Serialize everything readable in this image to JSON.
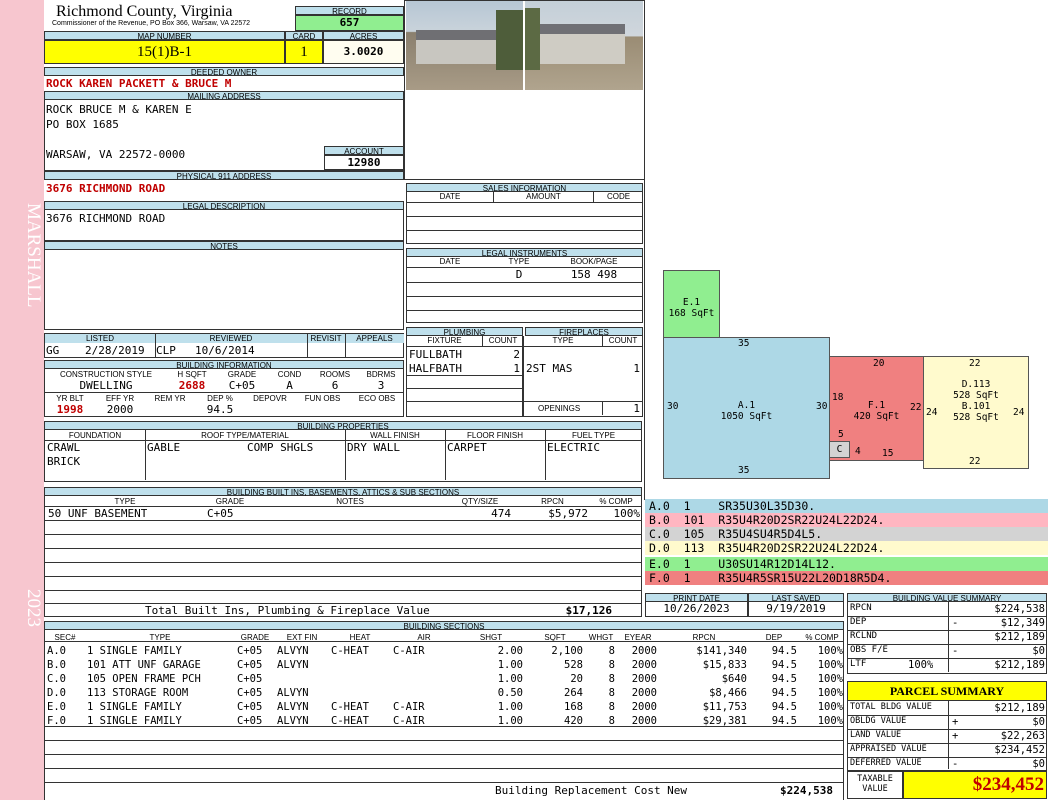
{
  "sidebar": {
    "owner_label": "MARSHALL",
    "year": "2023"
  },
  "header": {
    "county": "Richmond County, Virginia",
    "commissioner": "Commissioner of the Revenue, PO Box 366, Warsaw, VA 22572",
    "record_label": "RECORD",
    "record": "657",
    "map_label": "MAP NUMBER",
    "map_number": "15(1)B-1",
    "card_label": "CARD",
    "card": "1",
    "acres_label": "ACRES",
    "acres": "3.0020"
  },
  "owner": {
    "deeded_label": "DEEDED OWNER",
    "deeded": "ROCK KAREN PACKETT & BRUCE M",
    "mailing_label": "MAILING ADDRESS",
    "mailing_1": "ROCK BRUCE M & KAREN E",
    "mailing_2": "PO BOX 1685",
    "mailing_3": "WARSAW, VA 22572-0000",
    "account_label": "ACCOUNT",
    "account": "12980",
    "physical_label": "PHYSICAL 911 ADDRESS",
    "physical": "3676 RICHMOND ROAD",
    "legal_label": "LEGAL DESCRIPTION",
    "legal": "3676 RICHMOND ROAD",
    "notes_label": "NOTES"
  },
  "sales": {
    "title": "SALES INFORMATION",
    "cols": [
      "DATE",
      "AMOUNT",
      "CODE"
    ]
  },
  "legal_instruments": {
    "title": "LEGAL INSTRUMENTS",
    "cols": [
      "DATE",
      "TYPE",
      "BOOK/PAGE"
    ],
    "type": "D",
    "bookpage": "158 498"
  },
  "plumbing": {
    "title": "PLUMBING",
    "fixture_label": "FIXTURE",
    "count_label": "COUNT",
    "rows": [
      {
        "fixture": "FULLBATH",
        "count": "2"
      },
      {
        "fixture": "HALFBATH",
        "count": "1"
      }
    ]
  },
  "fireplaces": {
    "title": "FIREPLACES",
    "type_label": "TYPE",
    "count_label": "COUNT",
    "type": "2ST MAS",
    "count": "1",
    "openings_label": "OPENINGS",
    "openings": "1"
  },
  "listing": {
    "listed_label": "LISTED",
    "listed_by": "GG",
    "listed_date": "2/28/2019",
    "reviewed_label": "REVIEWED",
    "reviewed_by": "CLP",
    "reviewed_date": "10/6/2014",
    "revisit_label": "REVISIT",
    "appeals_label": "APPEALS"
  },
  "building_info": {
    "title": "BUILDING INFORMATION",
    "construction_label": "CONSTRUCTION STYLE",
    "construction": "DWELLING",
    "hsqft_label": "H SQFT",
    "hsqft": "2688",
    "grade_label": "GRADE",
    "grade": "C+05",
    "cond_label": "COND",
    "cond": "A",
    "rooms_label": "ROOMS",
    "rooms": "6",
    "bdrms_label": "BDRMS",
    "bdrms": "3",
    "yrblt_label": "YR BLT",
    "yrblt": "1998",
    "effyr_label": "EFF YR",
    "effyr": "2000",
    "remyr_label": "REM YR",
    "dep_label": "DEP %",
    "dep": "94.5",
    "depovr_label": "DEPOVR",
    "funobs_label": "FUN OBS",
    "ecoobs_label": "ECO OBS"
  },
  "properties": {
    "title": "BUILDING PROPERTIES",
    "foundation_label": "FOUNDATION",
    "foundation_1": "CRAWL",
    "foundation_2": "BRICK",
    "roof_label": "ROOF TYPE/MATERIAL",
    "roof_type": "GABLE",
    "roof_material": "COMP SHGLS",
    "wall_label": "WALL FINISH",
    "wall": "DRY WALL",
    "floor_label": "FLOOR FINISH",
    "floor": "CARPET",
    "fuel_label": "FUEL TYPE",
    "fuel": "ELECTRIC"
  },
  "builtins": {
    "title": "BUILDING BUILT INS, BASEMENTS, ATTICS & SUB SECTIONS",
    "cols": [
      "TYPE",
      "GRADE",
      "NOTES",
      "QTY/SIZE",
      "RPCN",
      "% COMP"
    ],
    "row": {
      "type": "50 UNF BASEMENT",
      "grade": "C+05",
      "qty": "474",
      "rpcn": "$5,972",
      "comp": "100%"
    },
    "total_label": "Total Built Ins, Plumbing & Fireplace Value",
    "total": "$17,126"
  },
  "segments": [
    {
      "id": "A.0",
      "code": "1",
      "path": "SR35U30L35D30.",
      "color": "#add8e6"
    },
    {
      "id": "B.0",
      "code": "101",
      "path": "R35U4R20D2SR22U24L22D24.",
      "color": "#ffb6c1"
    },
    {
      "id": "C.0",
      "code": "105",
      "path": "R35U4SU4R5D4L5.",
      "color": "#d3d3d3"
    },
    {
      "id": "D.0",
      "code": "113",
      "path": "R35U4R20D2SR22U24L22D24.",
      "color": "#fffacd"
    },
    {
      "id": "E.0",
      "code": "1",
      "path": "U30SU14R12D14L12.",
      "color": "#90ee90"
    },
    {
      "id": "F.0",
      "code": "1",
      "path": "R35U4R5SR15U22L20D18R5D4.",
      "color": "#f08080"
    }
  ],
  "sketch": {
    "e": {
      "label": "E.1",
      "area": "168 SqFt"
    },
    "a": {
      "label": "A.1",
      "area": "1050 SqFt",
      "top": "35",
      "bottom": "35",
      "left": "30",
      "right": "30"
    },
    "f": {
      "label": "F.1",
      "area": "420 SqFt",
      "top": "20",
      "left": "18",
      "right": "22",
      "bottom": "15"
    },
    "c": {
      "label": "C",
      "dim_top": "5",
      "dim_right": "4"
    },
    "d": {
      "label_d": "D.113",
      "area_d": "528 SqFt",
      "label_b": "B.101",
      "area_b": "528 SqFt",
      "top": "22",
      "bottom": "22",
      "left": "24",
      "right": "24"
    }
  },
  "dates": {
    "print_label": "PRINT DATE",
    "print": "10/26/2023",
    "saved_label": "LAST SAVED",
    "saved": "9/19/2019"
  },
  "value_summary": {
    "title": "BUILDING VALUE SUMMARY",
    "rows": [
      {
        "label": "RPCN",
        "sign": "",
        "pct": "",
        "value": "$224,538"
      },
      {
        "label": "DEP",
        "sign": "-",
        "pct": "",
        "value": "$12,349"
      },
      {
        "label": "RCLND",
        "sign": "",
        "pct": "",
        "value": "$212,189"
      },
      {
        "label": "OBS F/E",
        "sign": "-",
        "pct": "",
        "value": "$0"
      },
      {
        "label": "LTF",
        "sign": "",
        "pct": "100%",
        "value": "$212,189"
      }
    ]
  },
  "parcel": {
    "title": "PARCEL SUMMARY",
    "rows": [
      {
        "label": "TOTAL BLDG VALUE",
        "sign": "",
        "value": "$212,189"
      },
      {
        "label": "OBLDG VALUE",
        "sign": "+",
        "value": "$0"
      },
      {
        "label": "LAND VALUE",
        "sign": "+",
        "value": "$22,263"
      },
      {
        "label": "APPRAISED VALUE",
        "sign": "",
        "value": "$234,452"
      },
      {
        "label": "DEFERRED VALUE",
        "sign": "-",
        "value": "$0"
      }
    ],
    "taxable_label_1": "TAXABLE",
    "taxable_label_2": "VALUE",
    "taxable": "$234,452"
  },
  "sections": {
    "title": "BUILDING SECTIONS",
    "cols": [
      "SEC#",
      "TYPE",
      "GRADE",
      "EXT FIN",
      "HEAT",
      "AIR",
      "SHGT",
      "SQFT",
      "WHGT",
      "EYEAR",
      "RPCN",
      "DEP",
      "% COMP"
    ],
    "rows": [
      {
        "sec": "A.0",
        "type": "1 SINGLE FAMILY",
        "grade": "C+05",
        "ext": "ALVYN",
        "heat": "C-HEAT",
        "air": "C-AIR",
        "shgt": "2.00",
        "sqft": "2,100",
        "whgt": "8",
        "eyear": "2000",
        "rpcn": "$141,340",
        "dep": "94.5",
        "comp": "100%"
      },
      {
        "sec": "B.0",
        "type": "101 ATT UNF GARAGE",
        "grade": "C+05",
        "ext": "ALVYN",
        "heat": "",
        "air": "",
        "shgt": "1.00",
        "sqft": "528",
        "whgt": "8",
        "eyear": "2000",
        "rpcn": "$15,833",
        "dep": "94.5",
        "comp": "100%"
      },
      {
        "sec": "C.0",
        "type": "105 OPEN FRAME PCH",
        "grade": "C+05",
        "ext": "",
        "heat": "",
        "air": "",
        "shgt": "1.00",
        "sqft": "20",
        "whgt": "8",
        "eyear": "2000",
        "rpcn": "$640",
        "dep": "94.5",
        "comp": "100%"
      },
      {
        "sec": "D.0",
        "type": "113 STORAGE ROOM",
        "grade": "C+05",
        "ext": "ALVYN",
        "heat": "",
        "air": "",
        "shgt": "0.50",
        "sqft": "264",
        "whgt": "8",
        "eyear": "2000",
        "rpcn": "$8,466",
        "dep": "94.5",
        "comp": "100%"
      },
      {
        "sec": "E.0",
        "type": "1 SINGLE FAMILY",
        "grade": "C+05",
        "ext": "ALVYN",
        "heat": "C-HEAT",
        "air": "C-AIR",
        "shgt": "1.00",
        "sqft": "168",
        "whgt": "8",
        "eyear": "2000",
        "rpcn": "$11,753",
        "dep": "94.5",
        "comp": "100%"
      },
      {
        "sec": "F.0",
        "type": "1 SINGLE FAMILY",
        "grade": "C+05",
        "ext": "ALVYN",
        "heat": "C-HEAT",
        "air": "C-AIR",
        "shgt": "1.00",
        "sqft": "420",
        "whgt": "8",
        "eyear": "2000",
        "rpcn": "$29,381",
        "dep": "94.5",
        "comp": "100%"
      }
    ],
    "replacement_label": "Building Replacement Cost New",
    "replacement": "$224,538"
  }
}
